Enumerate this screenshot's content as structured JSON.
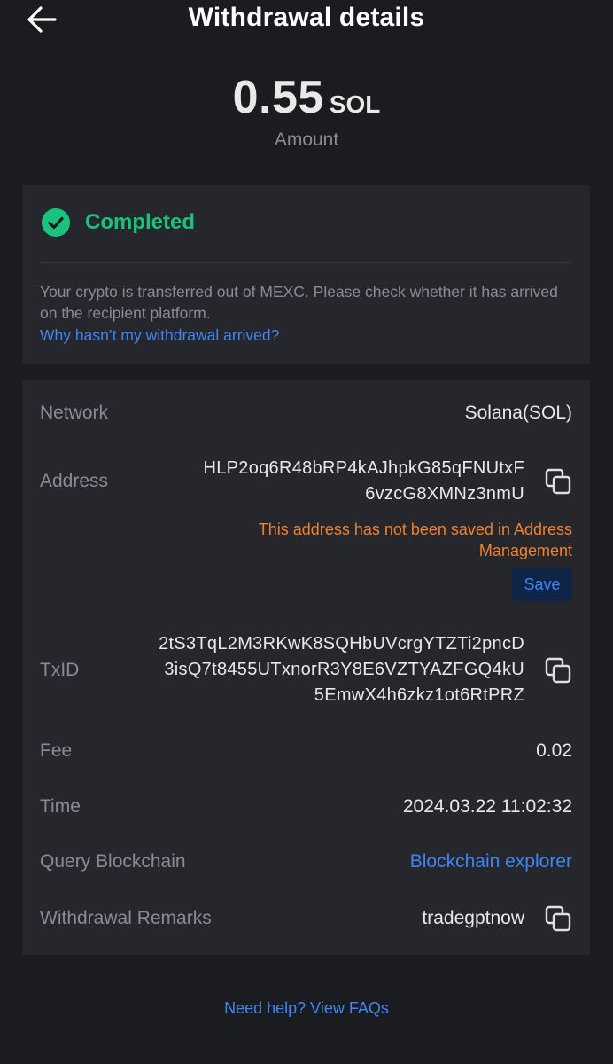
{
  "header": {
    "title": "Withdrawal details",
    "back_icon": "arrow-left-icon"
  },
  "amount": {
    "value": "0.55",
    "unit": "SOL",
    "label": "Amount"
  },
  "status": {
    "icon": "check-circle-icon",
    "text": "Completed",
    "message": "Your crypto is transferred out of MEXC. Please check whether it has arrived on the recipient platform.",
    "help_link": "Why hasn’t my withdrawal arrived?"
  },
  "details": {
    "network": {
      "label": "Network",
      "value": "Solana(SOL)"
    },
    "address": {
      "label": "Address",
      "line1": "HLP2oq6R48bRP4kAJhpkG85qFNUtxF",
      "line2": "6vzcG8XMNz3nmU",
      "warning_line1": "This address has not been saved in Address",
      "warning_line2": "Management",
      "save_label": "Save"
    },
    "txid": {
      "label": "TxID",
      "line1": "2tS3TqL2M3RKwK8SQHbUVcrgYTZTi2pncD",
      "line2": "3isQ7t8455UTxnorR3Y8E6VZTYAZFGQ4kU",
      "line3": "5EmwX4h6zkz1ot6RtPRZ"
    },
    "fee": {
      "label": "Fee",
      "value": "0.02"
    },
    "time": {
      "label": "Time",
      "value": "2024.03.22 11:02:32"
    },
    "query": {
      "label": "Query Blockchain",
      "value": "Blockchain explorer"
    },
    "remarks": {
      "label": "Withdrawal Remarks",
      "value": "tradegptnow"
    }
  },
  "footer": {
    "help_link": "Need help? View FAQs"
  },
  "colors": {
    "background": "#1b1c20",
    "card": "#26272c",
    "success": "#19c37d",
    "link": "#3e86f6",
    "warning": "#f0812f",
    "muted": "#8a8c93"
  }
}
